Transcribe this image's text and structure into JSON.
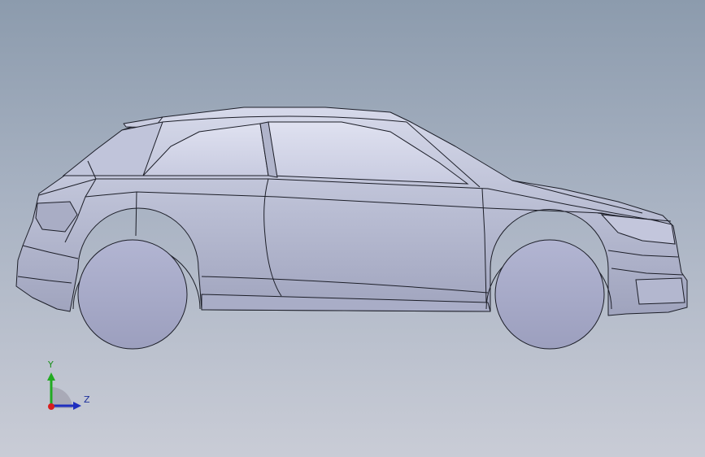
{
  "viewport": {
    "background_top": "#8c9bad",
    "background_bottom": "#c9ccd6"
  },
  "model": {
    "body_color": "#b7bbd2",
    "wheel_color": "#a7abca",
    "edge_color": "#1c1e28"
  },
  "triad": {
    "y_label": "Y",
    "z_label": "Z",
    "y_color": "#22aa22",
    "z_color": "#1f2fbf",
    "x_color": "#d81e1e"
  }
}
